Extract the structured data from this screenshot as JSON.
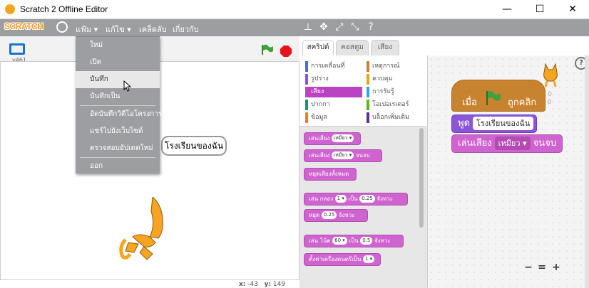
{
  "window": {
    "title": "Scratch 2 Offline Editor",
    "minimize": "—",
    "maximize": "☐",
    "close": "✕"
  },
  "menubar": {
    "logo": "SCRATCH",
    "file": "แฟ้ม ▾",
    "edit": "แก้ไข ▾",
    "tips": "เคล็ดลับ",
    "about": "เกี่ยวกับ"
  },
  "stage": {
    "version": "v461",
    "speech": "โรงเรียนของฉัน",
    "x_label": "x:",
    "x_value": "-43",
    "y_label": "y:",
    "y_value": "149"
  },
  "file_menu": {
    "items": [
      "ใหม่",
      "เปิด",
      "บันทึก",
      "บันทึกเป็น",
      "อัดบันทึกวิดีโอโครงการ",
      "แชร์ไปยังเว็บไซต์",
      "ตรวจสอบอัปเดตใหม่",
      "ออก"
    ],
    "highlighted": "บันทึก"
  },
  "tabs": {
    "scripts": "สคริปต์",
    "costumes": "คอสตูม",
    "sounds": "เสียง"
  },
  "categories": {
    "motion": "การเคลื่อนที่",
    "looks": "รูปร่าง",
    "sound": "เสียง",
    "pen": "ปากกา",
    "data": "ข้อมูล",
    "events": "เหตุการณ์",
    "control": "ควบคุม",
    "sensing": "การรับรู้",
    "operators": "โอเปอเรเตอร์",
    "more": "บล็อกเพิ่มเติม",
    "colors": {
      "motion": "#4a6cd4",
      "looks": "#8a55d7",
      "sound": "#bb42c3",
      "pen": "#0e9a6c",
      "data": "#ee7d16",
      "events": "#c88330",
      "control": "#e1a91a",
      "sensing": "#2ca5e2",
      "operators": "#5cb712",
      "more": "#632d99"
    }
  },
  "palette": {
    "b1": "เล่นเสียง",
    "b1s": "เหมียว ▾",
    "b2": "เล่นเสียง",
    "b2s": "เหมียว ▾",
    "b2e": "จนจบ",
    "b3": "หยุดเสียงทั้งหมด",
    "b4": "เล่น",
    "b4a": "กลอง",
    "b4s1": "1 ▾",
    "b4b": "เป็น",
    "b4s2": "0.25",
    "b4c": "จังหวะ",
    "b5": "หยุด",
    "b5s": "0.25",
    "b5b": "จังหวะ",
    "b6": "เล่น",
    "b6a": "โน้ต",
    "b6s1": "60 ▾",
    "b6b": "เป็น",
    "b6s2": "0.5",
    "b6c": "จังหวะ",
    "b7": "ตั้งค่าเครื่องดนตรีเป็น",
    "b7s": "1 ▾"
  },
  "script": {
    "hat_when": "เมื่อ",
    "hat_clicked": "ถูกคลิก",
    "say": "พูด",
    "say_text": "โรงเรียนของฉัน",
    "play": "เล่นเสียง",
    "play_sound": "เหมียว ▾",
    "play_until": "จนจบ",
    "sprite_x": "x: 0",
    "sprite_y": "y: 0"
  },
  "zoom": {
    "out": "−",
    "reset": "=",
    "in": "+"
  }
}
